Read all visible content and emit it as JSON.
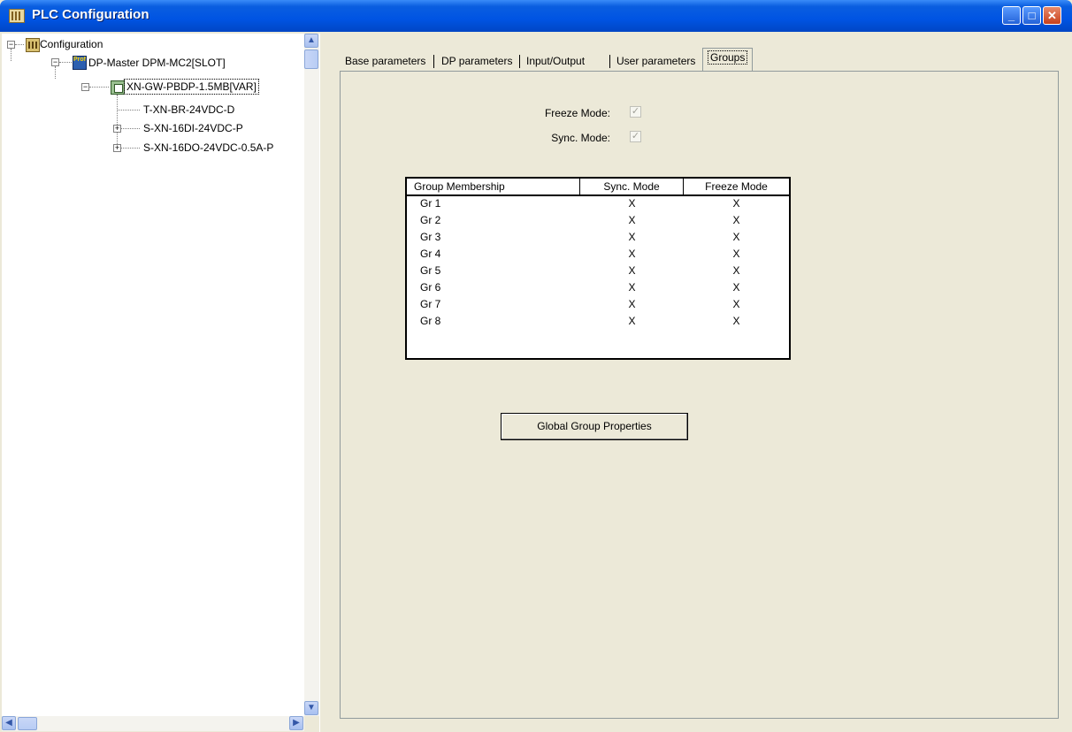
{
  "window": {
    "title": "PLC Configuration"
  },
  "tree": {
    "root": "Configuration",
    "master": "DP-Master DPM-MC2[SLOT]",
    "master_icon_text": "Profi",
    "slave": "XN-GW-PBDP-1.5MB[VAR]",
    "modules": [
      "T-XN-BR-24VDC-D",
      "S-XN-16DI-24VDC-P",
      "S-XN-16DO-24VDC-0.5A-P"
    ]
  },
  "tabs": [
    {
      "label": "Base parameters"
    },
    {
      "label": "DP parameters"
    },
    {
      "label": "Input/Output"
    },
    {
      "label": "User parameters"
    },
    {
      "label": "Groups"
    }
  ],
  "groups_tab": {
    "freeze_mode_label": "Freeze Mode:",
    "sync_mode_label": "Sync. Mode:",
    "freeze_mode_checked": true,
    "sync_mode_checked": true,
    "table": {
      "headers": [
        "Group Membership",
        "Sync. Mode",
        "Freeze Mode"
      ],
      "rows": [
        [
          "Gr 1",
          "X",
          "X"
        ],
        [
          "Gr 2",
          "X",
          "X"
        ],
        [
          "Gr 3",
          "X",
          "X"
        ],
        [
          "Gr 4",
          "X",
          "X"
        ],
        [
          "Gr 5",
          "X",
          "X"
        ],
        [
          "Gr 6",
          "X",
          "X"
        ],
        [
          "Gr 7",
          "X",
          "X"
        ],
        [
          "Gr 8",
          "X",
          "X"
        ]
      ]
    },
    "global_button": "Global Group Properties"
  },
  "colors": {
    "titlebar": "#0054e3",
    "face": "#ece9d8"
  }
}
